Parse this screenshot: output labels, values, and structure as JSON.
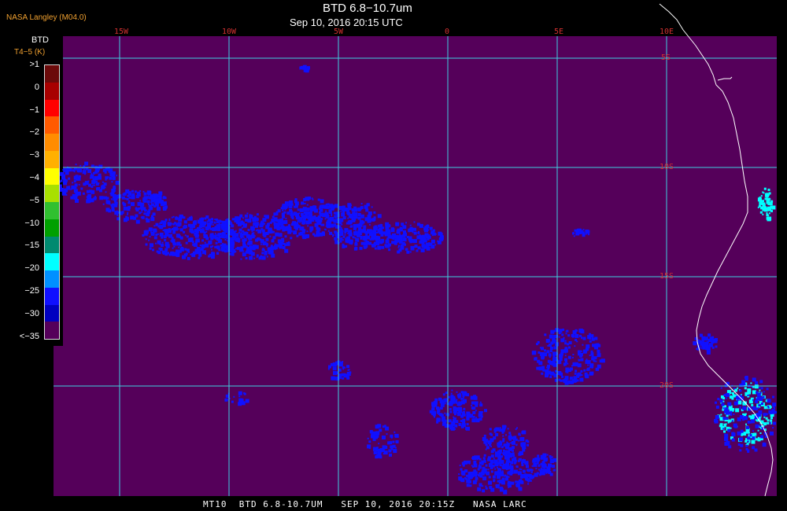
{
  "header": {
    "org_label": "NASA Langley (M04.0)",
    "title": "BTD 6.8−10.7um",
    "subtitle": "Sep 10, 2016 20:15 UTC"
  },
  "legend": {
    "title": "BTD",
    "units": "T4−5 (K)",
    "ticks": [
      ">1",
      "0",
      "−1",
      "−2",
      "−3",
      "−4",
      "−5",
      "−10",
      "−15",
      "−20",
      "−25",
      "−30",
      "<−35"
    ],
    "colors": [
      "#6b0a0a",
      "#a80000",
      "#ff0000",
      "#ff5a00",
      "#ff8c00",
      "#ffb000",
      "#ffff00",
      "#a8e000",
      "#30c030",
      "#00a000",
      "#008a70",
      "#00ffff",
      "#0090ff",
      "#1010ff",
      "#0000c0",
      "#55005a"
    ]
  },
  "graticule": {
    "lon_labels": [
      "15W",
      "10W",
      "5W",
      "0",
      "5E",
      "10E"
    ],
    "lat_labels": [
      "5S",
      "10S",
      "15S",
      "20S"
    ]
  },
  "footer": {
    "text": "MT10  BTD 6.8-10.7UM   SEP 10, 2016 20:15Z   NASA LARC"
  },
  "colors": {
    "background_field": "#55005a",
    "grid": "#40d0e0",
    "coast": "#ffffff",
    "cloud_blue": "#1010ff",
    "cloud_cyan": "#00ffff"
  }
}
